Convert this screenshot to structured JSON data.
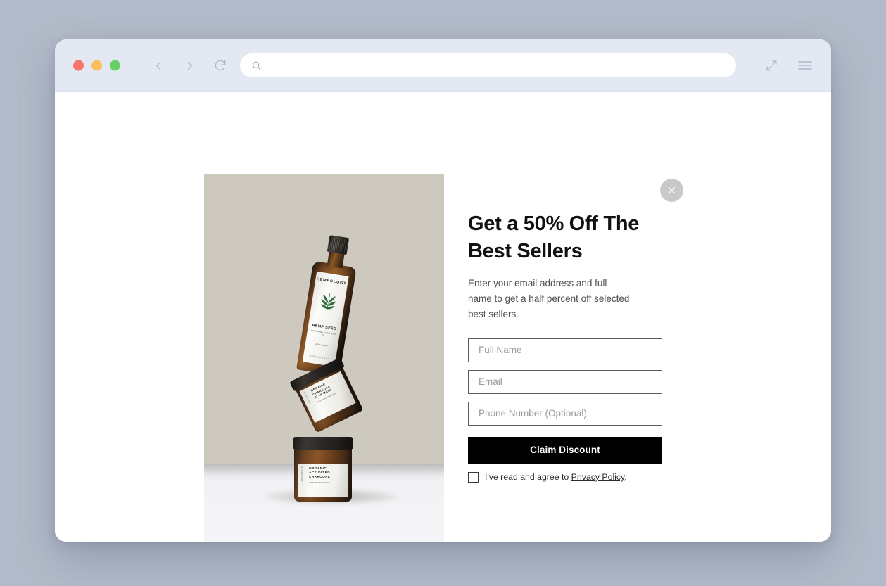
{
  "browser": {
    "traffic_lights": [
      "close",
      "minimize",
      "maximize"
    ],
    "back_label": "Back",
    "forward_label": "Forward",
    "reload_label": "Reload",
    "url_value": "",
    "url_placeholder": "",
    "expand_label": "Expand",
    "menu_label": "Menu",
    "colors": {
      "toolbar": "#e3e8f2",
      "red": "#f9736b",
      "yellow": "#f9c05b",
      "green": "#67d168",
      "icon": "#aeb8cb",
      "page_backdrop": "#b3bbca"
    }
  },
  "modal": {
    "close_label": "Close",
    "title": "Get a 50% Off The Best Sellers",
    "description": "Enter your email address and full name to get a half percent off selected best sellers.",
    "fields": [
      {
        "name": "full-name",
        "value": "",
        "placeholder": "Full Name"
      },
      {
        "name": "email",
        "value": "",
        "placeholder": "Email"
      },
      {
        "name": "phone",
        "value": "",
        "placeholder": "Phone Number (Optional)"
      }
    ],
    "submit_label": "Claim Discount",
    "consent": {
      "prefix": "I've read and agree to ",
      "link_label": "Privacy Policy",
      "suffix": ".",
      "checked": false
    },
    "colors": {
      "button_bg": "#000000",
      "button_text": "#ffffff",
      "title": "#111111",
      "body_text": "#4f4f4f",
      "field_border": "#5c5c5c",
      "close_bg": "#c9c9c9"
    }
  },
  "product_photo": {
    "alt": "Three amber glass skincare products stacked and balancing on a white surface against a beige backdrop",
    "backdrop_color": "#cdc9be",
    "surface_color": "#f3f3f6",
    "bottle": {
      "brand": "HEMPOLOGY",
      "product": "HEMP SEED",
      "subtitle": "NOURISHING FACE & BODY OIL",
      "note": "100% Organic",
      "volume": "100ml / 3.4 fl oz",
      "leaf_color": "#2f6b3a",
      "glass_color": "#8a5728"
    },
    "jar_tilted": {
      "line1": "ORGANIC",
      "line2": "CHARCOAL",
      "line3": "CLAY MASK",
      "subtitle": "DETOXIFYING TREATMENT",
      "side_text": "HEMPOLOGY"
    },
    "jar_bottom": {
      "line1": "ORGANIC",
      "line2": "ACTIVATED",
      "line3": "CHARCOAL",
      "subtitle": "PURIFYING FACE MASK",
      "side_text": "HEMPOLOGY"
    }
  }
}
